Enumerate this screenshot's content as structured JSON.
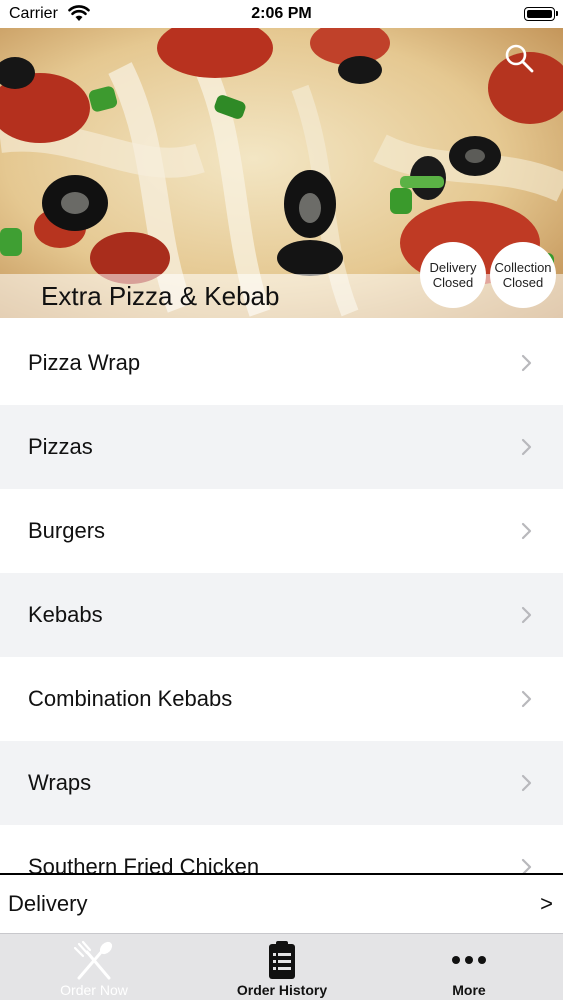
{
  "status_bar": {
    "carrier": "Carrier",
    "time": "2:06 PM"
  },
  "header": {
    "restaurant_name": "Extra Pizza & Kebab",
    "delivery_status": {
      "line1": "Delivery",
      "line2": "Closed"
    },
    "collection_status": {
      "line1": "Collection",
      "line2": "Closed"
    }
  },
  "menu": {
    "categories": [
      "Pizza Wrap",
      "Pizzas",
      "Burgers",
      "Kebabs",
      "Combination Kebabs",
      "Wraps",
      "Southern Fried Chicken"
    ]
  },
  "order_type": {
    "label": "Delivery",
    "arrow": ">"
  },
  "tabbar": {
    "order_now": "Order Now",
    "order_history": "Order History",
    "more": "More"
  },
  "colors": {
    "row_alt": "#f2f3f5",
    "tabbar": "#e4e4e6",
    "chevron": "#b8b8bc"
  }
}
